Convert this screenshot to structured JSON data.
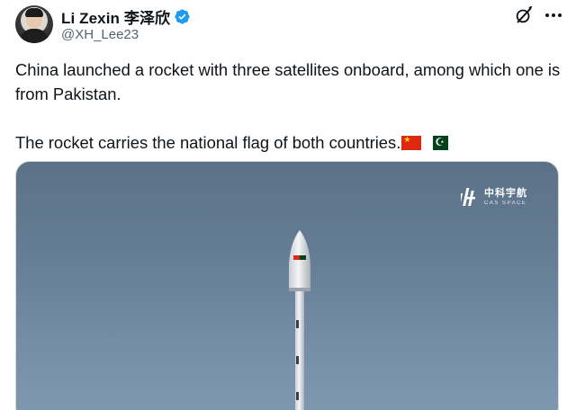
{
  "user": {
    "display_name": "Li Zexin 李泽欣",
    "handle": "@XH_Lee23",
    "verified": true,
    "verified_color": "#1d9bf0"
  },
  "header_icons": {
    "grok": "grok-icon",
    "more": "more-options-icon"
  },
  "tweet": {
    "line1": "China launched a rocket with three satellites onboard, among which one is from Pakistan.",
    "line2": "The rocket carries the national flag of both countries.",
    "flags": [
      "flag-china-icon",
      "flag-pakistan-icon"
    ]
  },
  "media": {
    "watermark_cn": "中科宇航",
    "watermark_en": "CAS SPACE",
    "sky_color": "#6b8399"
  }
}
